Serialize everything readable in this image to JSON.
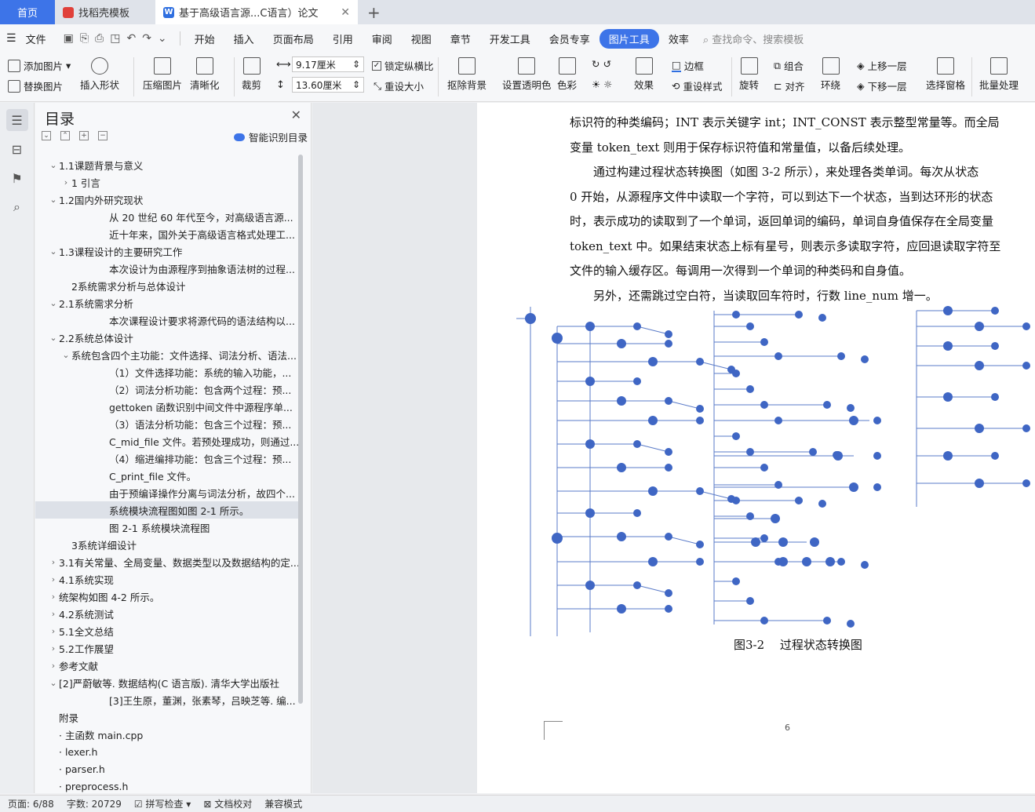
{
  "tabs": {
    "home": "首页",
    "tab2": "找稻壳模板",
    "tab3": "基于高级语言源...C语言）论文",
    "add": "+"
  },
  "menu": {
    "file": "文件",
    "items": [
      "开始",
      "插入",
      "页面布局",
      "引用",
      "审阅",
      "视图",
      "章节",
      "开发工具",
      "会员专享",
      "图片工具",
      "效率"
    ],
    "search": "查找命令、搜索模板"
  },
  "ribbon": {
    "add_image": "添加图片",
    "replace_image": "替换图片",
    "insert_shape": "插入形状",
    "compress": "压缩图片",
    "sharpen": "清晰化",
    "crop": "裁剪",
    "width": "9.17厘米",
    "height": "13.60厘米",
    "lock_ratio": "锁定纵横比",
    "reset_size": "重设大小",
    "remove_bg": "抠除背景",
    "transparent": "设置透明色",
    "color": "色彩",
    "effects": "效果",
    "border": "边框",
    "reset_style": "重设样式",
    "rotate": "旋转",
    "group": "组合",
    "align": "对齐",
    "wrap": "环绕",
    "bring_forward": "上移一层",
    "send_backward": "下移一层",
    "select_pane": "选择窗格",
    "batch": "批量处理"
  },
  "toc": {
    "title": "目录",
    "smart": "智能识别目录",
    "items": [
      {
        "label": "1.1课题背景与意义",
        "chev": "v",
        "indent": 1
      },
      {
        "label": "1 引言",
        "chev": ">",
        "indent": 2
      },
      {
        "label": "1.2国内外研究现状",
        "chev": "v",
        "indent": 1
      },
      {
        "label": "从 20 世纪 60 年代至今，对高级语言源...",
        "chev": "",
        "indent": 5
      },
      {
        "label": "近十年来，国外关于高级语言格式处理工...",
        "chev": "",
        "indent": 5
      },
      {
        "label": "1.3课程设计的主要研究工作",
        "chev": "v",
        "indent": 1
      },
      {
        "label": "本次设计为由源程序到抽象语法树的过程...",
        "chev": "",
        "indent": 5
      },
      {
        "label": "2系统需求分析与总体设计",
        "chev": "",
        "indent": 2
      },
      {
        "label": "2.1系统需求分析",
        "chev": "v",
        "indent": 1
      },
      {
        "label": "本次课程设计要求将源代码的语法结构以...",
        "chev": "",
        "indent": 5
      },
      {
        "label": "2.2系统总体设计",
        "chev": "v",
        "indent": 1
      },
      {
        "label": "系统包含四个主功能：文件选择、词法分析、语法...",
        "chev": "v",
        "indent": 2
      },
      {
        "label": "（1）文件选择功能：系统的输入功能，...",
        "chev": "",
        "indent": 5
      },
      {
        "label": "（2）词法分析功能：包含两个过程：预...",
        "chev": "",
        "indent": 5
      },
      {
        "label": "gettoken 函数识别中间文件中源程序单...",
        "chev": "",
        "indent": 5
      },
      {
        "label": "（3）语法分析功能：包含三个过程：预...",
        "chev": "",
        "indent": 5
      },
      {
        "label": "C_mid_file 文件。若预处理成功，则通过...",
        "chev": "",
        "indent": 5
      },
      {
        "label": "（4）缩进编排功能：包含三个过程：预...",
        "chev": "",
        "indent": 5
      },
      {
        "label": "C_print_file 文件。",
        "chev": "",
        "indent": 5
      },
      {
        "label": "由于预编译操作分离与词法分析，故四个...",
        "chev": "",
        "indent": 5
      },
      {
        "label": "系统模块流程图如图 2-1 所示。",
        "chev": "",
        "indent": 5,
        "hl": true
      },
      {
        "label": "图 2-1  系统模块流程图",
        "chev": "",
        "indent": 5
      },
      {
        "label": "3系统详细设计",
        "chev": "",
        "indent": 2
      },
      {
        "label": "3.1有关常量、全局变量、数据类型以及数据结构的定...",
        "chev": ">",
        "indent": 1
      },
      {
        "label": "4.1系统实现",
        "chev": ">",
        "indent": 1
      },
      {
        "label": "统架构如图 4-2 所示。",
        "chev": ">",
        "indent": 1
      },
      {
        "label": "4.2系统测试",
        "chev": ">",
        "indent": 1
      },
      {
        "label": "5.1全文总结",
        "chev": ">",
        "indent": 1
      },
      {
        "label": "5.2工作展望",
        "chev": ">",
        "indent": 1
      },
      {
        "label": "参考文献",
        "chev": ">",
        "indent": 1
      },
      {
        "label": "[2]严蔚敏等. 数据结构(C 语言版). 清华大学出版社",
        "chev": "v",
        "indent": 1
      },
      {
        "label": "[3]王生原，董渊，张素琴，吕映芝等. 编...",
        "chev": "",
        "indent": 5
      },
      {
        "label": "附录",
        "chev": "",
        "indent": 1
      },
      {
        "label": "· 主函数 main.cpp",
        "chev": "",
        "indent": 1
      },
      {
        "label": "· lexer.h",
        "chev": "",
        "indent": 1
      },
      {
        "label": "· parser.h",
        "chev": "",
        "indent": 1
      },
      {
        "label": "· preprocess.h",
        "chev": "",
        "indent": 1
      }
    ]
  },
  "doc": {
    "lines": [
      "标识符的种类编码；INT 表示关键字 int；INT_CONST 表示整型常量等。而全局",
      "变量 token_text 则用于保存标识符值和常量值，以备后续处理。",
      "　　通过构建过程状态转换图（如图 3-2 所示），来处理各类单词。每次从状态",
      "0 开始，从源程序文件中读取一个字符，可以到达下一个状态，当到达环形的状态",
      "时，表示成功的读取到了一个单词，返回单词的编码，单词自身值保存在全局变量",
      "token_text 中。如果结束状态上标有星号，则表示多读取字符，应回退读取字符至",
      "文件的输入缓存区。每调用一次得到一个单词的种类码和自身值。",
      "　　另外，还需跳过空白符，当读取回车符时，行数 line_num 增一。"
    ],
    "caption": "图3-2　 过程状态转换图",
    "page_number": "6"
  },
  "status": {
    "page": "页面: 6/88",
    "words": "字数: 20729",
    "spell": "拼写检查",
    "proof": "文档校对",
    "compat": "兼容模式"
  },
  "colors": {
    "accent": "#3d74e8",
    "node": "#3f66c4"
  }
}
